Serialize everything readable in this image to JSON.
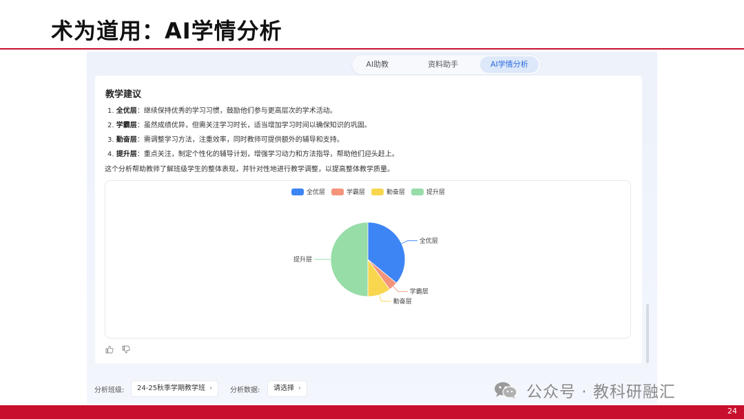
{
  "slide": {
    "title": "术为道用：AI学情分析",
    "page_number": "24"
  },
  "tabs": [
    {
      "label": "AI助教",
      "active": false
    },
    {
      "label": "资料助手",
      "active": false
    },
    {
      "label": "AI学情分析",
      "active": true
    }
  ],
  "advice": {
    "title": "教学建议",
    "items": [
      {
        "index": "1.",
        "tag": "全优层",
        "text": "：继续保持优秀的学习习惯，鼓励他们参与更高层次的学术活动。"
      },
      {
        "index": "2.",
        "tag": "学霸层",
        "text": "：虽然成绩优异，但需关注学习时长，适当增加学习时间以确保知识的巩固。"
      },
      {
        "index": "3.",
        "tag": "勤奋层",
        "text": "：需调整学习方法，注重效率，同时教师可提供额外的辅导和支持。"
      },
      {
        "index": "4.",
        "tag": "提升层",
        "text": "：重点关注，制定个性化的辅导计划，增强学习动力和方法指导，帮助他们迎头赶上。"
      }
    ],
    "summary": "这个分析帮助教师了解班级学生的整体表现，并针对性地进行教学调整，以提高整体教学质量。"
  },
  "chart_data": {
    "type": "pie",
    "categories": [
      "全优层",
      "学霸层",
      "勤奋层",
      "提升层"
    ],
    "values": [
      36,
      4,
      10,
      50
    ],
    "colors": [
      "#3d84f5",
      "#f4947a",
      "#f8d64e",
      "#97dda8"
    ],
    "legend_placement": "top-center"
  },
  "feedback": {
    "like_icon": "thumbs-up-icon",
    "dislike_icon": "thumbs-down-icon"
  },
  "controls": {
    "class_label": "分析班级:",
    "class_value": "24-25秋季学期教学班",
    "data_label": "分析数据:",
    "data_value": "请选择",
    "chevron": "›"
  },
  "watermark": {
    "text": "公众号 · 教科研融汇",
    "icon": "wechat-icon"
  },
  "colors": {
    "brand_red": "#c8102e",
    "accent_blue": "#2d6bdf"
  }
}
